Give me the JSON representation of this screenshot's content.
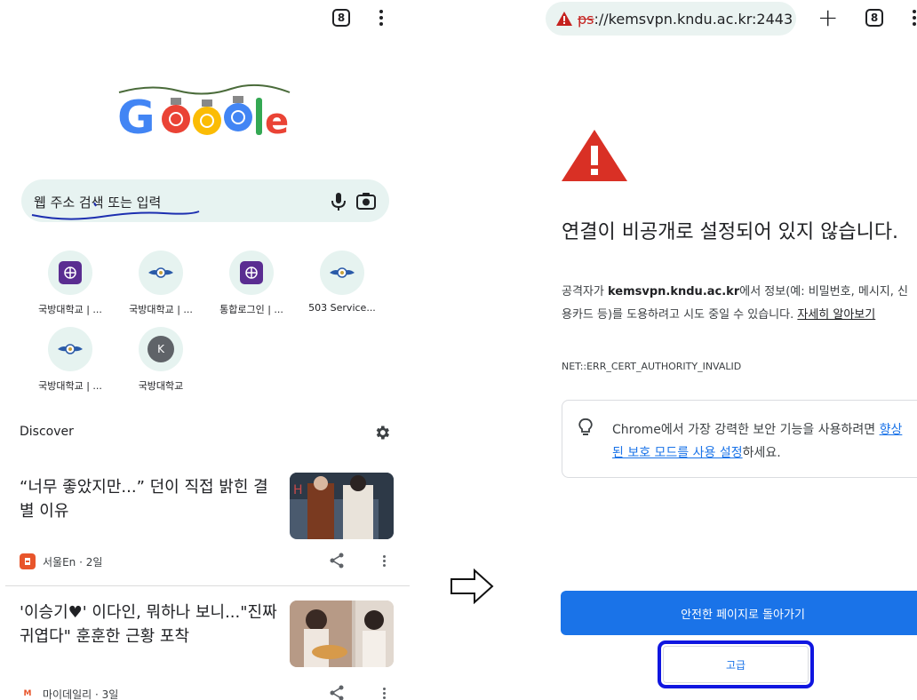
{
  "left_phone": {
    "tab_count": "8",
    "search": {
      "placeholder": "웹 주소 검색 또는 입력"
    },
    "shortcuts": [
      {
        "label": "국방대학교 | ...",
        "icon": "kndu-purple-emblem-icon"
      },
      {
        "label": "국방대학교 | ...",
        "icon": "kndu-emblem-icon"
      },
      {
        "label": "통합로그인 | ...",
        "icon": "kndu-purple-emblem-icon"
      },
      {
        "label": "503 Service...",
        "icon": "kndu-emblem-icon"
      },
      {
        "label": "국방대학교 | ...",
        "icon": "kndu-emblem-icon"
      },
      {
        "label": "국방대학교",
        "icon": "letter-avatar-icon",
        "avatar_letter": "K"
      }
    ],
    "discover": {
      "title": "Discover"
    },
    "cards": [
      {
        "title": "“너무 좋았지만...” 던이 직접 밝힌 결별 이유",
        "source": "서울En · 2일",
        "source_icon_color": "#e8552b",
        "source_icon_letter": "In"
      },
      {
        "title": "'이승기♥' 이다인, 뭐하나 보니...\"진짜 귀엽다\" 훈훈한 근황 포착",
        "source": "마이데일리 · 3일",
        "source_icon_color": "#e8552b",
        "source_icon_letter": "M"
      }
    ]
  },
  "right_phone": {
    "url_scheme": "ps",
    "url_rest": "://kemsvpn.kndu.ac.kr:2443",
    "tab_count": "8",
    "title": "연결이 비공개로 설정되어 있지 않습니다.",
    "body_prefix": "공격자가 ",
    "body_host": "kemsvpn.kndu.ac.kr",
    "body_suffix": "에서 정보(예: 비밀번호, 메시지, 신용카드 등)를 도용하려고 시도 중일 수 있습니다. ",
    "learn_more": "자세히 알아보기",
    "error_code": "NET::ERR_CERT_AUTHORITY_INVALID",
    "tip_prefix": "Chrome에서 가장 강력한 보안 기능을 사용하려면 ",
    "tip_link": "향상된 보호 모드를 사용 설정",
    "tip_suffix": "하세요.",
    "back_button": "안전한 페이지로 돌아가기",
    "advanced_button": "고급"
  },
  "colors": {
    "accent_blue": "#1a73e8",
    "warning_red": "#d93025",
    "highlight_ring": "#1016e0"
  }
}
